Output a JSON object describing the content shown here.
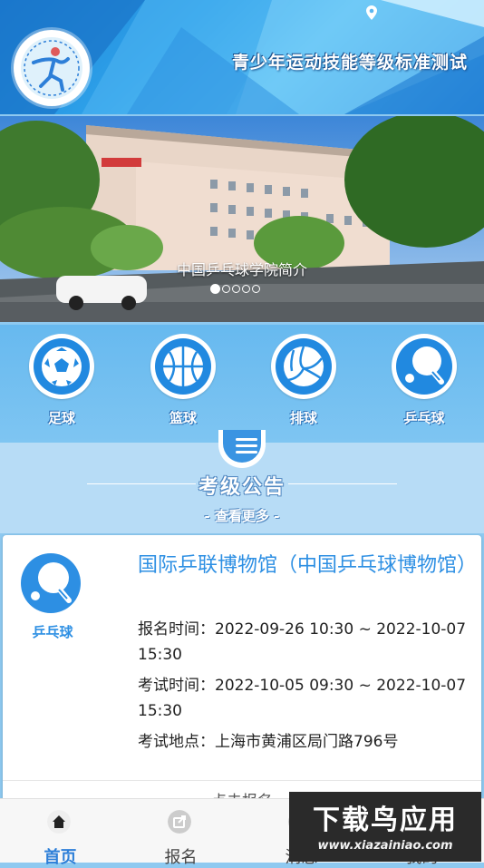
{
  "header": {
    "title": "青少年运动技能等级标准测试",
    "logo_icon": "athlete-logo-icon"
  },
  "banner": {
    "caption": "中国乒乓球学院简介",
    "slides_count": 5,
    "active_slide": 1
  },
  "categories": [
    {
      "label": "足球",
      "icon": "soccer-ball-icon"
    },
    {
      "label": "篮球",
      "icon": "basketball-icon"
    },
    {
      "label": "排球",
      "icon": "volleyball-icon"
    },
    {
      "label": "乒乓球",
      "icon": "ping-pong-icon"
    }
  ],
  "notice": {
    "title": "考级公告",
    "more": "- 查看更多 -"
  },
  "card": {
    "sport_label": "乒乓球",
    "title": "国际乒联博物馆（中国乒乓球博物馆）",
    "signup_time": "报名时间：2022-09-26 10:30 ~ 2022-10-07 15:30",
    "exam_time": "考试时间：2022-10-05 09:30 ~ 2022-10-07 15:30",
    "exam_place": "考试地点：上海市黄浦区局门路796号",
    "action": "点击报名"
  },
  "nav": {
    "items": [
      {
        "label": "首页",
        "icon": "home-icon",
        "active": true
      },
      {
        "label": "报名",
        "icon": "share-icon",
        "active": false
      },
      {
        "label": "消息",
        "icon": "message-icon",
        "active": false
      },
      {
        "label": "我的",
        "icon": "user-icon",
        "active": false
      }
    ]
  },
  "watermark": {
    "main": "下载鸟应用",
    "sub": "www.xiazainiao.com"
  },
  "colors": {
    "primary": "#2d8fe3",
    "nav_active": "#2d7fd8",
    "notice_bg": "#b7dcf6"
  }
}
